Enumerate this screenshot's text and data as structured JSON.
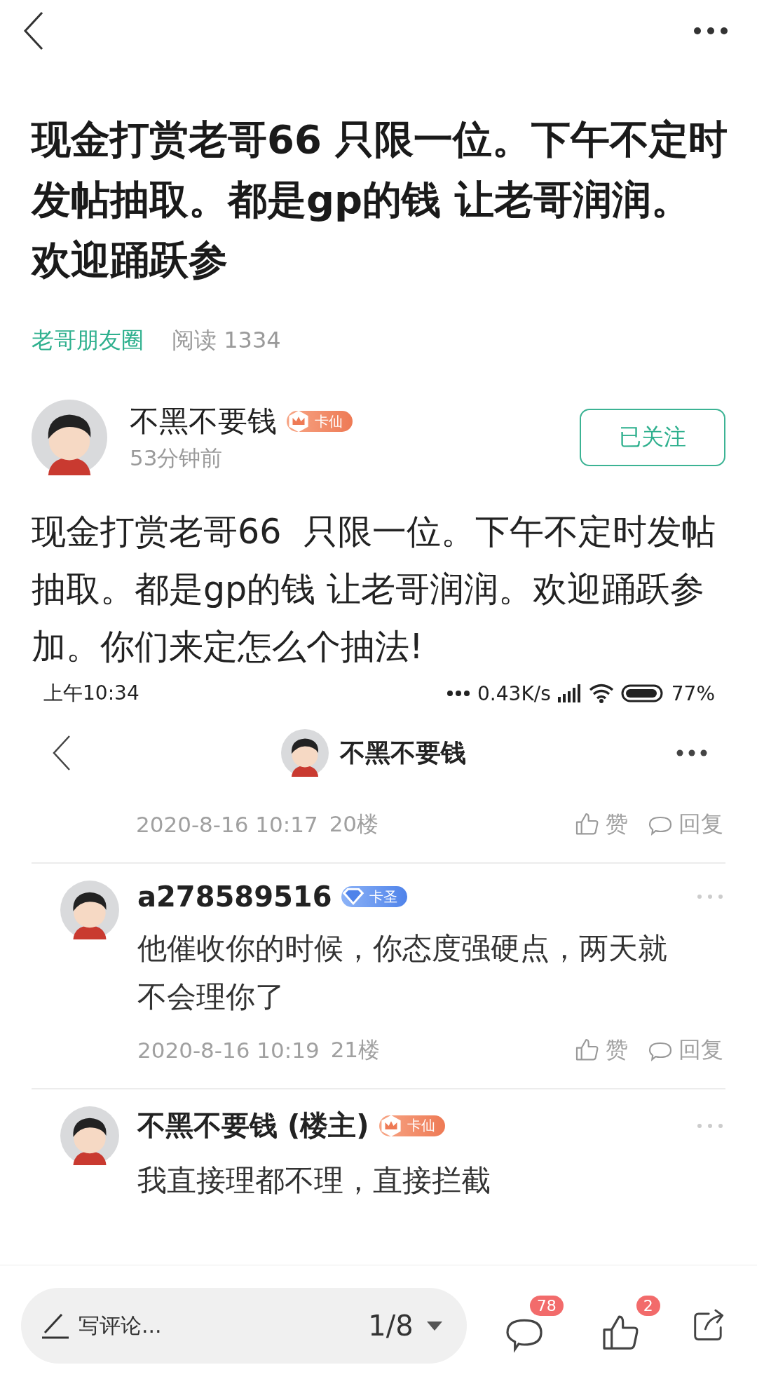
{
  "post": {
    "title": "现金打赏老哥66 只限一位。下午不定时发帖抽取。都是gp的钱 让老哥润润。欢迎踊跃参",
    "circle": "老哥朋友圈",
    "reads": "阅读 1334",
    "author": {
      "name": "不黑不要钱",
      "badge": {
        "kind": "crown",
        "label": "卡仙"
      },
      "time": "53分钟前"
    },
    "follow_button": "已关注",
    "body": "现金打赏老哥66  只限一位。下午不定时发帖抽取。都是gp的钱 让老哥润润。欢迎踊跃参加。你们来定怎么个抽法!"
  },
  "screenshot": {
    "status_bar": {
      "time": "上午10:34",
      "speed": "0.43K/s",
      "battery": "77%"
    },
    "nav": {
      "title": "不黑不要钱"
    },
    "prev_footer": {
      "timestamp": "2020-8-16 10:17",
      "floor": "20楼",
      "like": "赞",
      "reply": "回复"
    },
    "comments": [
      {
        "name": "a278589516",
        "badge": {
          "kind": "diamond",
          "label": "卡圣"
        },
        "text": "他催收你的时候，你态度强硬点，两天就不会理你了",
        "footer": {
          "timestamp": "2020-8-16 10:19",
          "floor": "21楼",
          "like": "赞",
          "reply": "回复"
        }
      },
      {
        "name": "不黑不要钱 (楼主)",
        "badge": {
          "kind": "crown",
          "label": "卡仙"
        },
        "text": "我直接理都不理，直接拦截"
      }
    ]
  },
  "bottom_bar": {
    "placeholder": "写评论...",
    "page": "1/8",
    "comment_count": "78",
    "like_count": "2"
  }
}
